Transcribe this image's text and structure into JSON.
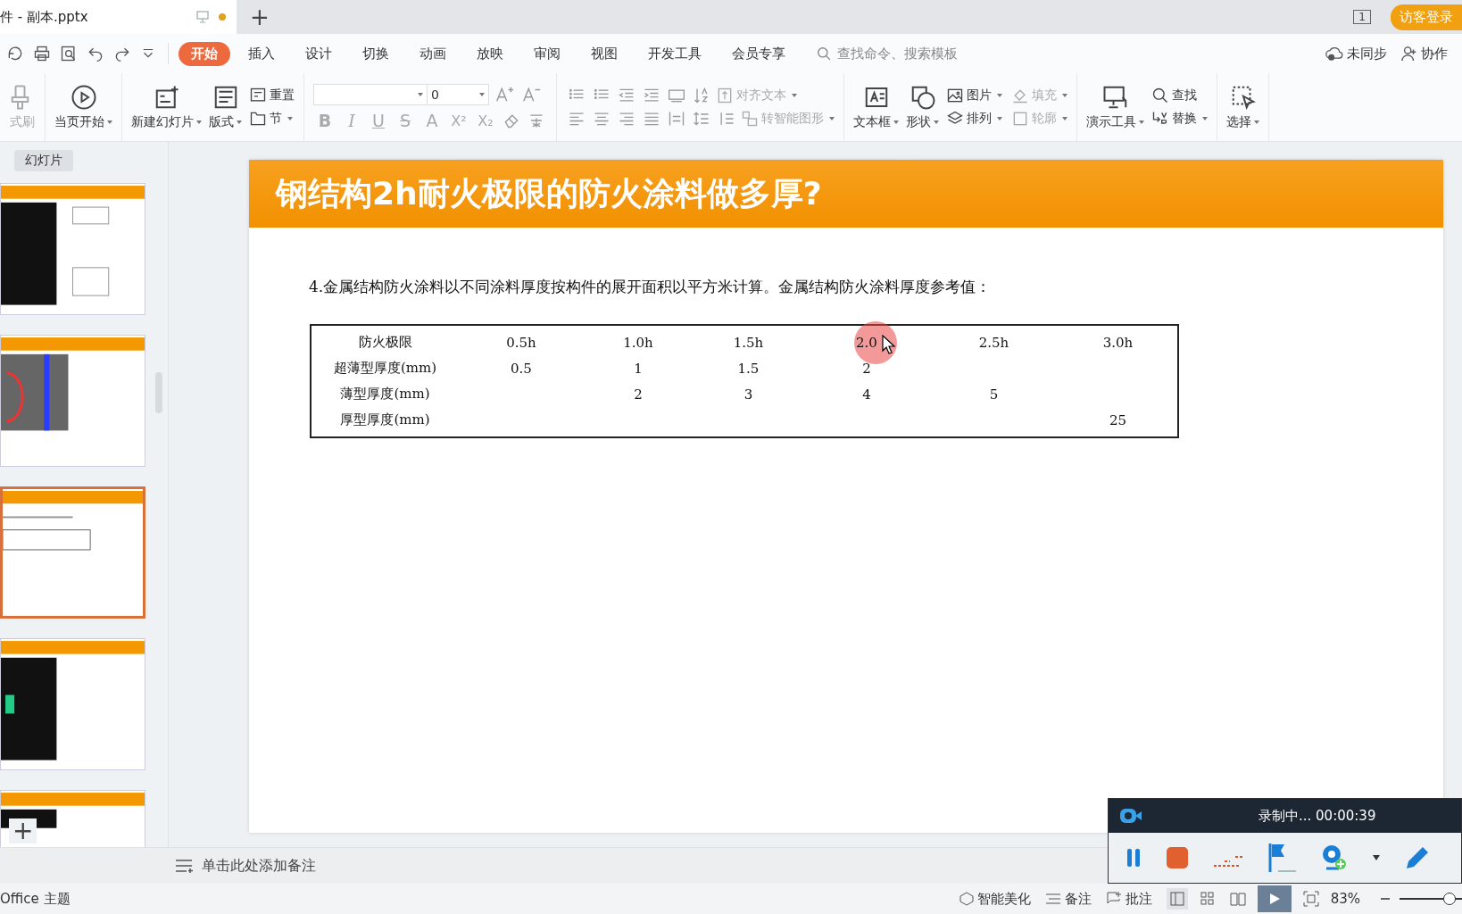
{
  "title_bar": {
    "document_tab": {
      "title": "件 - 副本.pptx",
      "unsaved": true
    },
    "new_tab": "+",
    "page_count": "1",
    "login_button": "访客登录"
  },
  "menu": {
    "tabs": [
      {
        "label": "开始",
        "selected": true
      },
      {
        "label": "插入",
        "selected": false
      },
      {
        "label": "设计",
        "selected": false
      },
      {
        "label": "切换",
        "selected": false
      },
      {
        "label": "动画",
        "selected": false
      },
      {
        "label": "放映",
        "selected": false
      },
      {
        "label": "审阅",
        "selected": false
      },
      {
        "label": "视图",
        "selected": false
      },
      {
        "label": "开发工具",
        "selected": false
      },
      {
        "label": "会员专享",
        "selected": false
      }
    ],
    "search": {
      "placeholder": "查找命令、搜索模板"
    },
    "sync": "未同步",
    "collaborate": "协作"
  },
  "ribbon": {
    "groups": [
      {
        "kind": "buttons",
        "items": [
          {
            "label": "式刷",
            "kind": "large",
            "dropdown": false,
            "disabled": true
          }
        ]
      },
      {
        "kind": "buttons",
        "items": [
          {
            "label": "当页开始",
            "kind": "large",
            "dropdown": true,
            "disabled": false
          }
        ]
      },
      {
        "kind": "buttons",
        "items": [
          {
            "label": "新建幻灯片",
            "kind": "large",
            "dropdown": true,
            "disabled": false
          },
          {
            "label": "版式",
            "kind": "large",
            "dropdown": true,
            "disabled": false
          },
          {
            "label": "重置",
            "kind": "small",
            "dropdown": false,
            "disabled": false
          },
          {
            "label": "节",
            "kind": "small",
            "dropdown": true,
            "disabled": false
          }
        ]
      },
      {
        "kind": "font",
        "size_value": "0",
        "format_buttons": [
          {
            "label": "B",
            "disabled": true
          },
          {
            "label": "I",
            "disabled": true
          },
          {
            "label": "U",
            "disabled": true
          },
          {
            "label": "S",
            "disabled": true
          },
          {
            "label": "A",
            "disabled": true
          },
          {
            "label": "X²",
            "disabled": true
          },
          {
            "label": "X₂",
            "disabled": true
          }
        ]
      },
      {
        "kind": "paragraph",
        "items": [
          {
            "label": "对齐文本",
            "dropdown": true,
            "disabled": true
          },
          {
            "label": "转智能图形",
            "dropdown": true,
            "disabled": true
          }
        ]
      },
      {
        "kind": "buttons",
        "items": [
          {
            "label": "文本框",
            "kind": "large",
            "dropdown": true,
            "disabled": false
          },
          {
            "label": "形状",
            "kind": "large",
            "dropdown": true,
            "disabled": false
          },
          {
            "label": "图片",
            "kind": "small",
            "dropdown": true,
            "disabled": false
          },
          {
            "label": "排列",
            "kind": "small",
            "dropdown": true,
            "disabled": false
          },
          {
            "label": "填充",
            "kind": "small",
            "dropdown": true,
            "disabled": true
          },
          {
            "label": "轮廓",
            "kind": "small",
            "dropdown": true,
            "disabled": true
          }
        ]
      },
      {
        "kind": "buttons",
        "items": [
          {
            "label": "演示工具",
            "kind": "large",
            "dropdown": true,
            "disabled": false
          },
          {
            "label": "查找",
            "kind": "small",
            "dropdown": false,
            "disabled": false
          },
          {
            "label": "替换",
            "kind": "small",
            "dropdown": true,
            "disabled": false
          }
        ]
      },
      {
        "kind": "buttons",
        "items": [
          {
            "label": "选择",
            "kind": "large",
            "dropdown": true,
            "disabled": false
          }
        ]
      }
    ]
  },
  "slide_panel": {
    "tabs": [
      {
        "label": "幻灯片",
        "selected": true
      }
    ],
    "slides": [
      {
        "kind": "picture",
        "selected": false
      },
      {
        "kind": "picture",
        "selected": false
      },
      {
        "kind": "picture",
        "selected": true
      },
      {
        "kind": "picture",
        "selected": false
      },
      {
        "kind": "picture",
        "selected": false
      }
    ],
    "add_slide": "+"
  },
  "slide": {
    "title": "钢结构2h耐火极限的防火涂料做多厚?",
    "paragraph": "4.金属结构防火涂料以不同涂料厚度按构件的展开面积以平方米计算。金属结构防火涂料厚度参考值：",
    "table": {
      "rows": [
        [
          "防火极限",
          "0.5h",
          "1.0h",
          "1.5h",
          "2.0",
          "2.5h",
          "3.0h"
        ],
        [
          "超薄型厚度(mm)",
          "0.5",
          "1",
          "1.5",
          "2",
          null,
          null
        ],
        [
          "薄型厚度(mm)",
          null,
          "2",
          "3",
          "4",
          "5",
          null
        ],
        [
          "厚型厚度(mm)",
          null,
          null,
          null,
          null,
          null,
          "25"
        ]
      ]
    }
  },
  "notes": {
    "placeholder": "单击此处添加备注"
  },
  "recorder": {
    "status": "录制中... 00:00:39"
  },
  "status_bar": {
    "theme": "Office 主题",
    "beautify": "智能美化",
    "notes": "备注",
    "comments": "批注",
    "zoom": "83%",
    "zoom_slider": {
      "level": 0.8
    }
  }
}
